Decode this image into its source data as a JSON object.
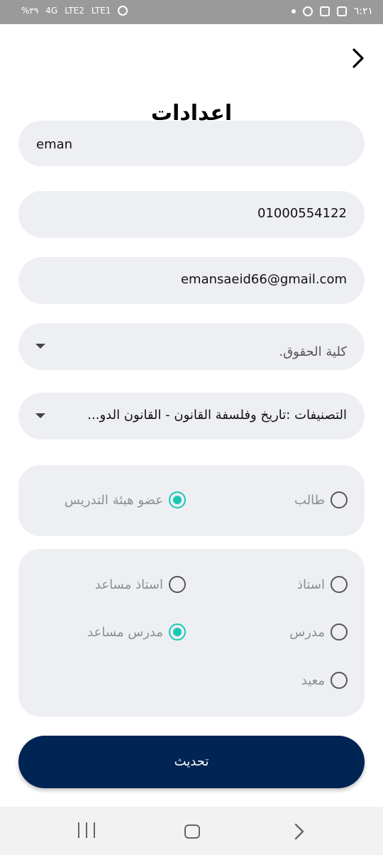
{
  "status_bar": {
    "time": "٦:٢١",
    "battery": "%٣٩",
    "network_1": "4G",
    "network_label_1": "LTE2",
    "network_label_2": "LTE1"
  },
  "header": {
    "title": "اعدادات"
  },
  "form": {
    "name": "eman",
    "phone": "01000554122",
    "email": "emansaeid66@gmail.com",
    "faculty_placeholder": "كلية الحقوق.",
    "classifications": "التصنيفات :تاريخ وفلسفة القانون - القانون الدو..."
  },
  "role_group": {
    "options": [
      {
        "label": "طالب",
        "selected": false
      },
      {
        "label": "عضو هيئة التدريس",
        "selected": true
      }
    ]
  },
  "rank_group": {
    "options": [
      {
        "label": "استاذ",
        "selected": false
      },
      {
        "label": "استاذ مساعد",
        "selected": false
      },
      {
        "label": "مدرس",
        "selected": false
      },
      {
        "label": "مدرس مساعد",
        "selected": true
      },
      {
        "label": "معيد",
        "selected": false
      }
    ]
  },
  "actions": {
    "update_label": "تحديث"
  },
  "colors": {
    "accent": "#19c8b4",
    "button": "#002453",
    "field_bg": "#eeeff3"
  }
}
